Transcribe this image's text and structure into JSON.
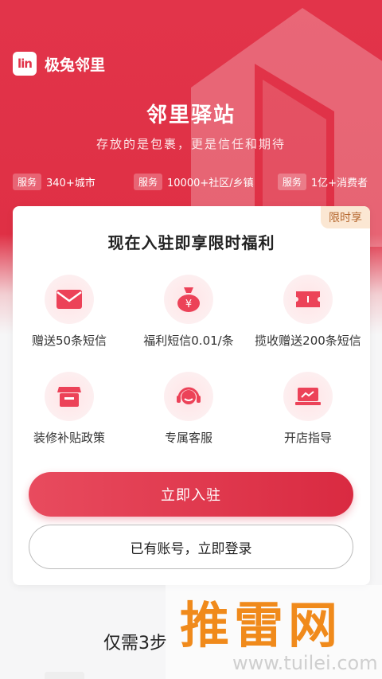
{
  "brand": {
    "logo_mark": "lin",
    "name": "极兔邻里"
  },
  "hero": {
    "title": "邻里驿站",
    "subtitle": "存放的是包裹，更是信任和期待"
  },
  "stats": [
    {
      "tag": "服务",
      "text": "340+城市"
    },
    {
      "tag": "服务",
      "text": "10000+社区/乡镇"
    },
    {
      "tag": "服务",
      "text": "1亿+消费者"
    }
  ],
  "card": {
    "badge": "限时享",
    "title": "现在入驻即享限时福利",
    "benefits": [
      {
        "icon": "envelope-icon",
        "label": "赠送50条短信"
      },
      {
        "icon": "money-bag-icon",
        "label": "福利短信0.01/条"
      },
      {
        "icon": "ticket-icon",
        "label": "揽收赠送200条短信"
      },
      {
        "icon": "shop-icon",
        "label": "装修补贴政策"
      },
      {
        "icon": "headset-icon",
        "label": "专属客服"
      },
      {
        "icon": "laptop-chart-icon",
        "label": "开店指导"
      }
    ],
    "primary_button": "立即入驻",
    "secondary_button": "已有账号，立即登录"
  },
  "steps": {
    "title": "仅需3步"
  },
  "watermark": {
    "big": "推雷网",
    "url": "www.tuilei.com"
  },
  "colors": {
    "brand_red": "#e2344a",
    "badge_bg": "#fbe7d3",
    "watermark_orange": "#f08a1b"
  }
}
